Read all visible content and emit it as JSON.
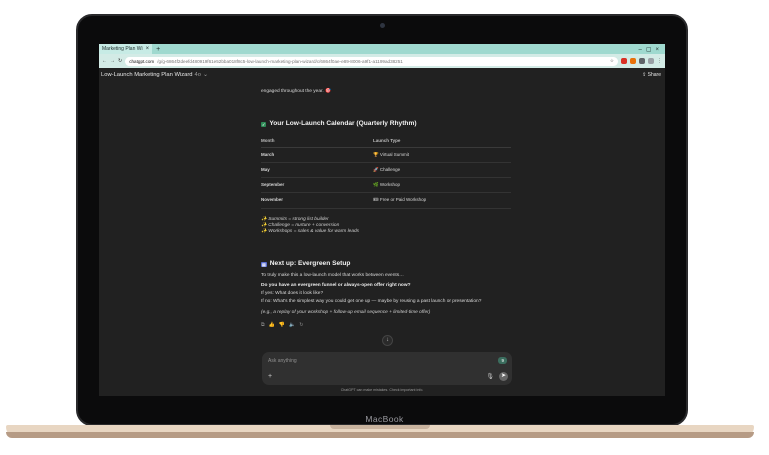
{
  "device": {
    "brand_label": "MacBook"
  },
  "browser": {
    "tab_title": "Marketing Plan Wi",
    "new_tab": "+",
    "url_host": "chatgpt.com",
    "url_path": "/g/g-6864f2deefd480919f61e52bba018f8c5-low-launch-marketing-plan-wizard/c/6864f0ae-e89-8006-a9f1-a1199ad38251"
  },
  "app": {
    "conversation_title": "Low-Launch Marketing Plan Wizard",
    "model": "4o",
    "share_label": "Share"
  },
  "chat": {
    "intro_text": "engaged throughout the year. 🎯",
    "calendar_heading": "Your Low-Launch Calendar (Quarterly Rhythm)",
    "table": {
      "headers": [
        "Month",
        "Launch Type"
      ],
      "rows": [
        {
          "month": "March",
          "type": "🏆 Virtual Summit"
        },
        {
          "month": "May",
          "type": "🚀 Challenge"
        },
        {
          "month": "September",
          "type": "🌿 Workshop"
        },
        {
          "month": "November",
          "type": "🎟 Free or Paid Workshop"
        }
      ]
    },
    "bullets": [
      "✨ Summits = strong list builder",
      "✨ Challenge = nurture + conversion",
      "✨ Workshops = sales & value for warm leads"
    ],
    "next_heading": "Next up: Evergreen Setup",
    "next_intro": "To truly make this a low-launch model that works between events…",
    "question": "Do you have an evergreen funnel or always-open offer right now?",
    "if_yes": "If yes: What does it look like?",
    "if_no": "If no: What's the simplest way you could get one up — maybe by reusing a past launch or presentation?",
    "example": "(e.g., a replay of your workshop + follow-up email sequence + limited-time offer)"
  },
  "composer": {
    "placeholder": "Ask anything",
    "badge": "9",
    "footer_note": "ChatGPT can make mistakes. Check important info."
  },
  "icons": {
    "copy": "copy-icon",
    "thumb_up": "thumbs-up-icon",
    "thumb_down": "thumbs-down-icon",
    "read_aloud": "speaker-icon",
    "regenerate": "refresh-icon",
    "scroll_down": "arrow-down-icon"
  }
}
